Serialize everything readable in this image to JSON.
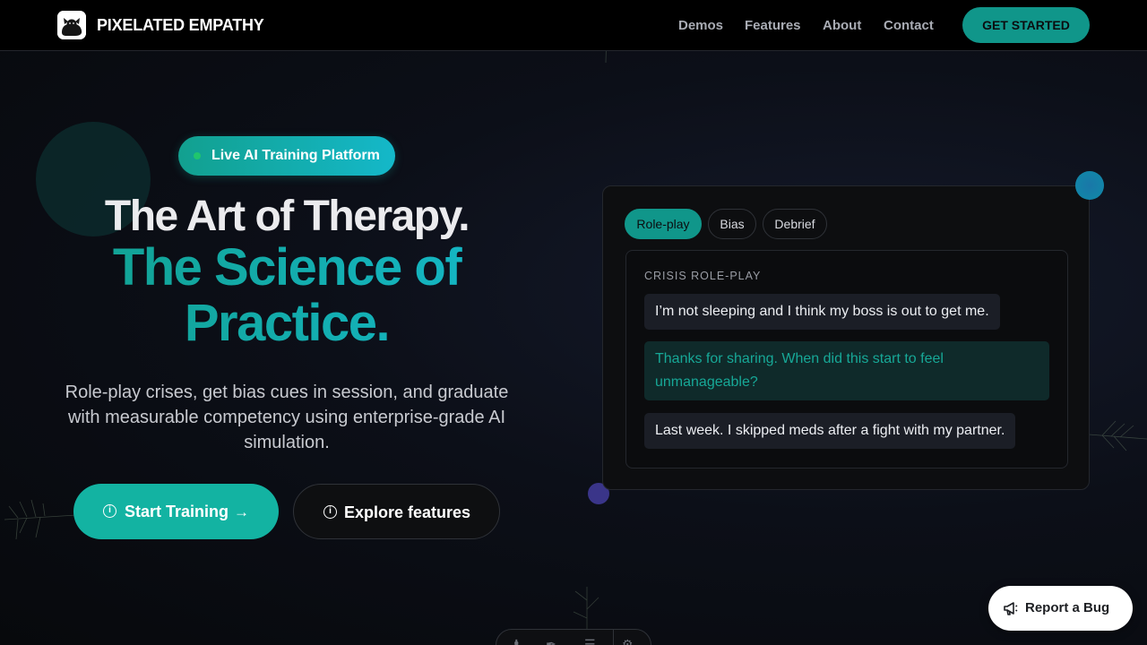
{
  "nav": {
    "brand": "PIXELATED EMPATHY",
    "links": [
      "Demos",
      "Features",
      "About",
      "Contact"
    ],
    "cta": "GET STARTED"
  },
  "hero": {
    "badge": "Live AI Training Platform",
    "headline_line1": "The Art of Therapy.",
    "headline_line2": "The Science of",
    "headline_line3": "Practice.",
    "subtext": "Role-play crises, get bias cues in session, and graduate with measurable competency using enterprise-grade AI simulation.",
    "primary_button": "Start Training",
    "primary_arrow": "→",
    "secondary_button": "Explore features"
  },
  "demo": {
    "tabs": [
      "Role-play",
      "Bias",
      "Debrief"
    ],
    "active_tab": "Role-play",
    "section_label": "CRISIS ROLE-PLAY",
    "messages": [
      {
        "role": "client",
        "text": "I’m not sleeping and I think my boss is out to get me."
      },
      {
        "role": "therapist",
        "text": "Thanks for sharing. When did this start to feel unmanageable?"
      },
      {
        "role": "client",
        "text": "Last week. I skipped meds after a fight with my partner."
      }
    ]
  },
  "report_bug": "Report a Bug",
  "colors": {
    "accent": "#13b3a2",
    "accent_dark": "#10968a",
    "accent_cyan": "#14b8c9",
    "background": "#07090c"
  },
  "icons": {
    "logo": "cat-logo-icon",
    "badge_dot": "live-dot-icon",
    "button_info": "info-icon",
    "report": "megaphone-icon",
    "dock": [
      "user-icon",
      "brush-icon",
      "menu-icon",
      "settings-icon"
    ]
  }
}
